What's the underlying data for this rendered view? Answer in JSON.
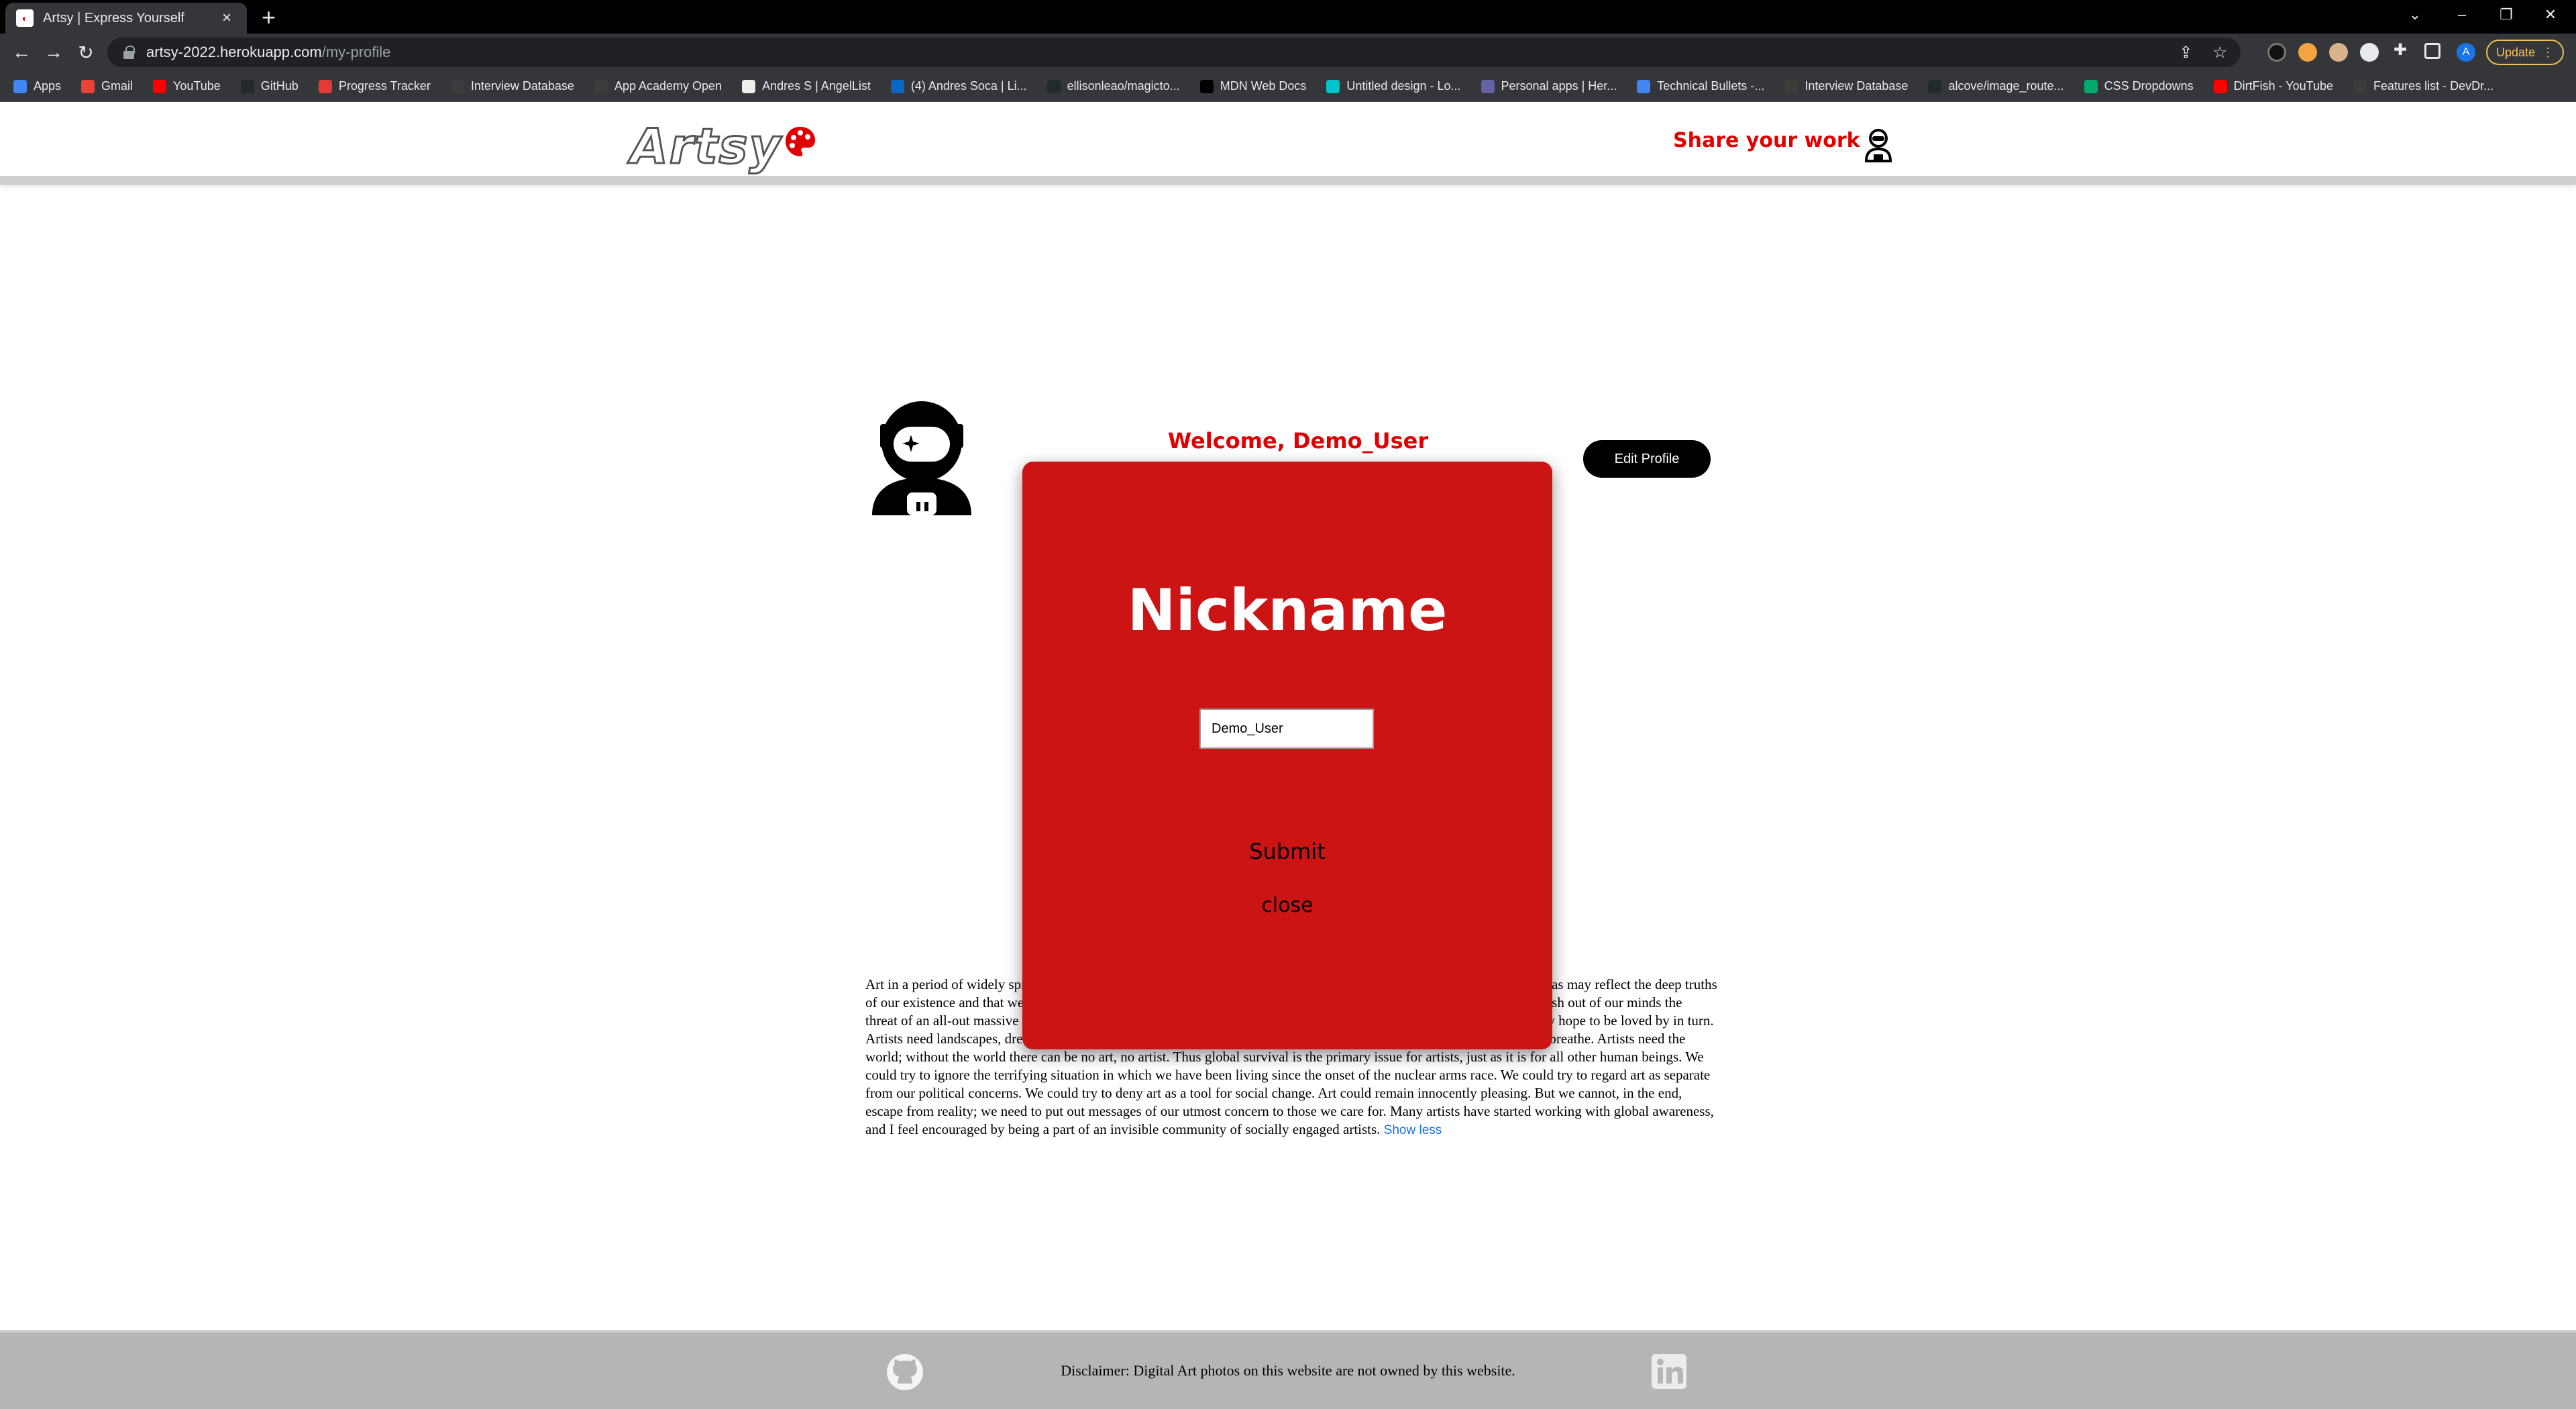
{
  "browser": {
    "tab_title": "Artsy | Express Yourself",
    "url_host": "artsy-2022.herokuapp.com",
    "url_path": "/my-profile",
    "update_label": "Update",
    "bookmarks": [
      {
        "label": "Apps",
        "color": "#4285f4"
      },
      {
        "label": "Gmail",
        "color": "#ea4335"
      },
      {
        "label": "YouTube",
        "color": "#ff0000"
      },
      {
        "label": "GitHub",
        "color": "#24292e"
      },
      {
        "label": "Progress Tracker",
        "color": "#e53935"
      },
      {
        "label": "Interview Database",
        "color": "#3c3c3c"
      },
      {
        "label": "App Academy Open",
        "color": "#3c3c3c"
      },
      {
        "label": "Andres S | AngelList",
        "color": "#eeeeee"
      },
      {
        "label": "(4) Andres Soca | Li...",
        "color": "#0a66c2"
      },
      {
        "label": "ellisonleao/magicto...",
        "color": "#24292e"
      },
      {
        "label": "MDN Web Docs",
        "color": "#000000"
      },
      {
        "label": "Untitled design - Lo...",
        "color": "#00c4cc"
      },
      {
        "label": "Personal apps | Her...",
        "color": "#6762a6"
      },
      {
        "label": "Technical Bullets -...",
        "color": "#4285f4"
      },
      {
        "label": "Interview Database",
        "color": "#3c3c3c"
      },
      {
        "label": "alcove/image_route...",
        "color": "#24292e"
      },
      {
        "label": "CSS Dropdowns",
        "color": "#04aa6d"
      },
      {
        "label": "DirtFish - YouTube",
        "color": "#ff0000"
      },
      {
        "label": "Features list - DevDr...",
        "color": "#3c3c3c"
      }
    ]
  },
  "header": {
    "logo": "Artsy",
    "share_link": "Share your work"
  },
  "profile": {
    "welcome": "Welcome, Demo_User",
    "edit_button": "Edit Profile",
    "bio": "Art in a period of widely spreading destruction and feeling of despair. We could pretend that ripples of lake water on canvas may reflect the deep truths of our existence and that we need not think of our messages about the millions for whom half an egg is a meal. We can push out of our minds the threat of an all-out massive nuclear attack that could occur at any moment. Artists love; they love life and beauty, and they hope to be loved by in turn. Artists need landscapes, dreams, and ideas. Just like other beings, artists need earth to stand on, water to drink, and air to breathe. Artists need the world; without the world there can be no art, no artist. Thus global survival is the primary issue for artists, just as it is for all other human beings. We could try to ignore the terrifying situation in which we have been living since the onset of the nuclear arms race. We could try to regard art as separate from our political concerns. We could try to deny art as a tool for social change. Art could remain innocently pleasing. But we cannot, in the end, escape from reality; we need to put out messages of our utmost concern to those we care for. Many artists have started working with global awareness, and I feel encouraged by being a part of an invisible community of socially engaged artists.",
    "show_less": "Show less"
  },
  "modal": {
    "title": "Nickname",
    "input_value": "Demo_User",
    "submit_label": "Submit",
    "close_label": "close"
  },
  "footer": {
    "disclaimer": "Disclaimer: Digital Art photos on this website are not owned by this website."
  },
  "colors": {
    "accent_red": "#e00000",
    "modal_red": "#cc1414"
  }
}
